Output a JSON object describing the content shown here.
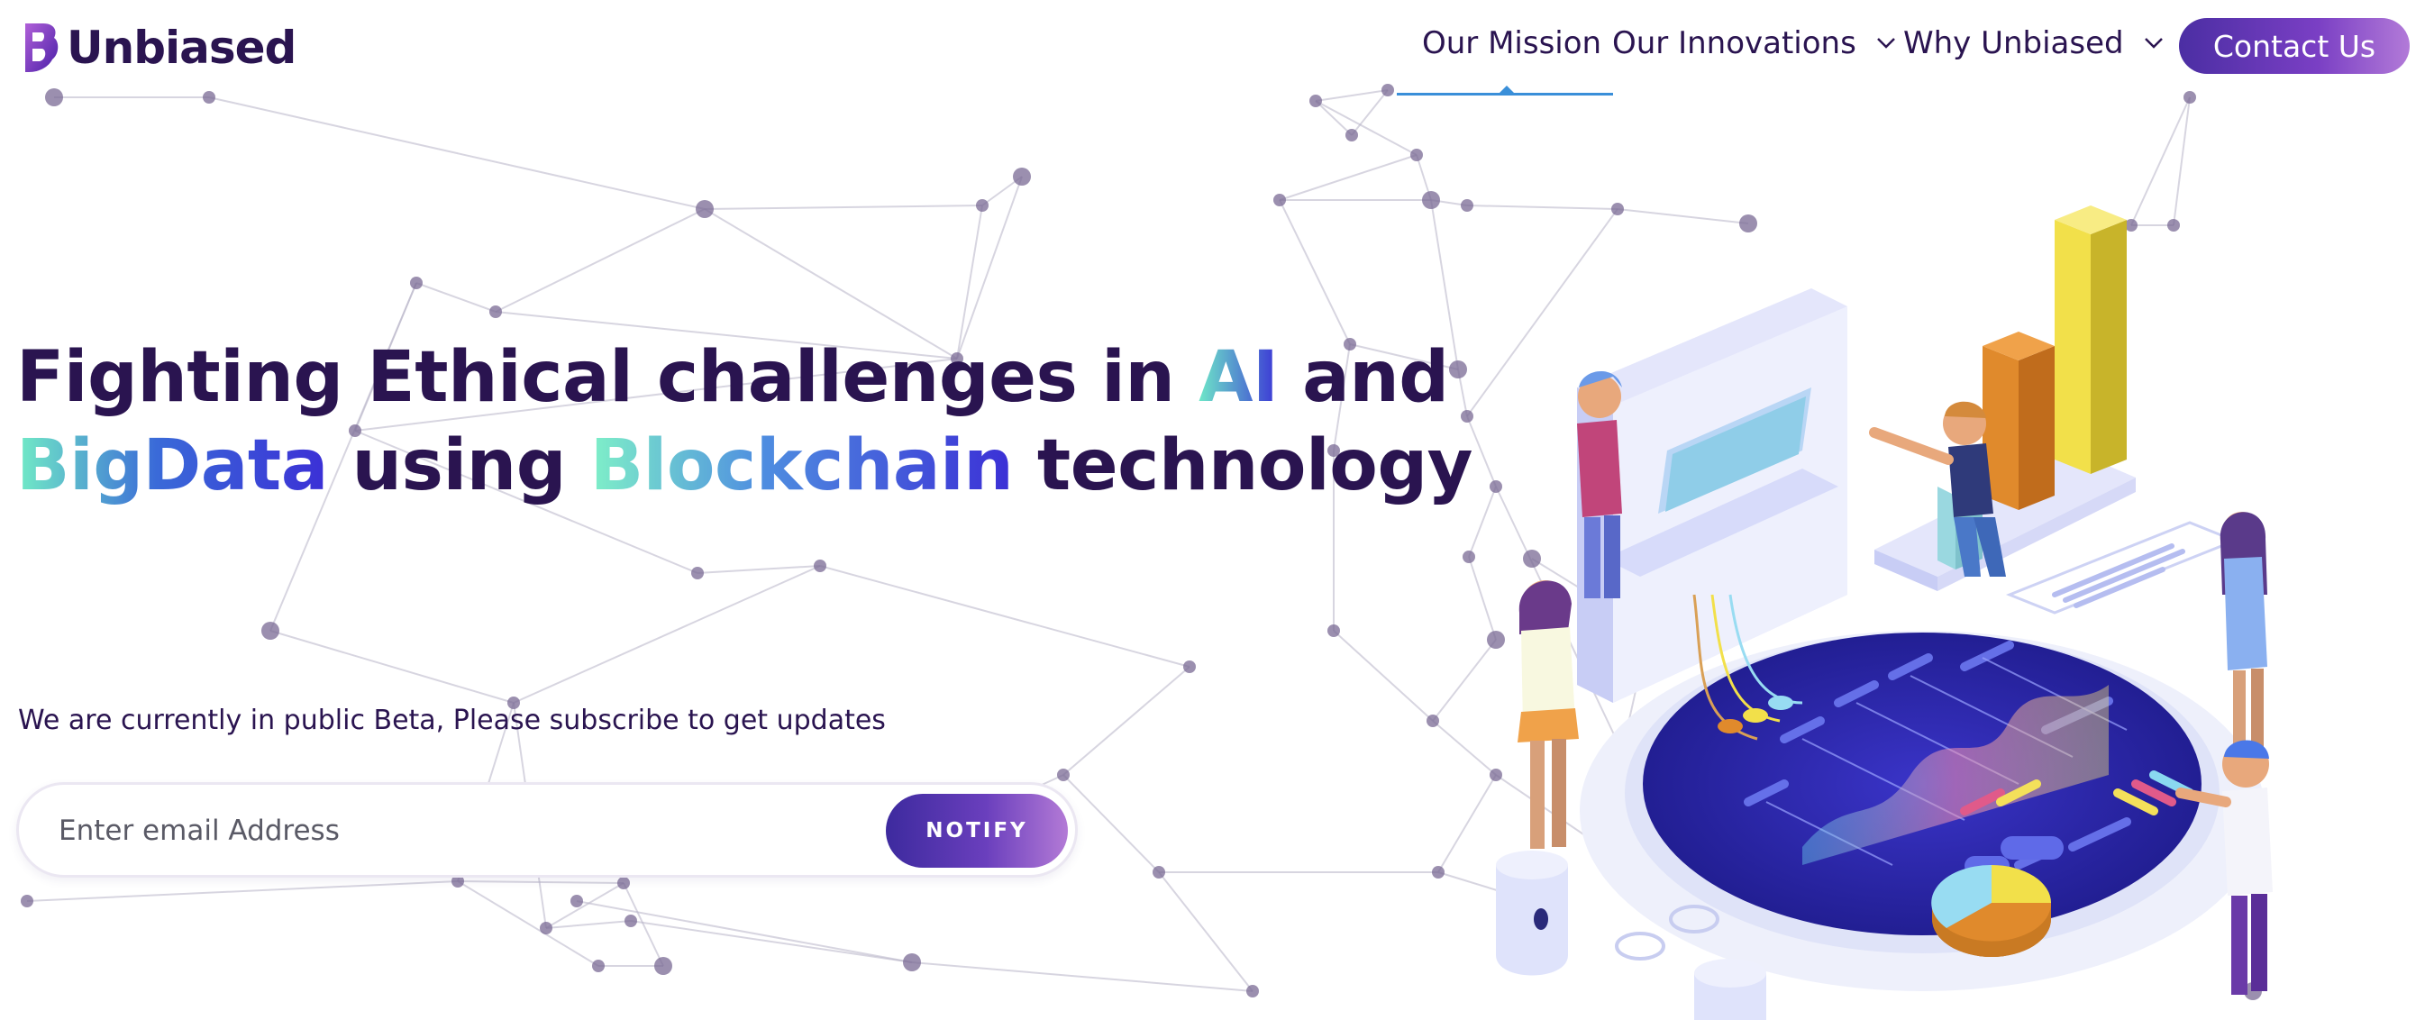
{
  "brand": {
    "name": "Unbiased",
    "logo_icon": "unbiased-b-logo",
    "colors": {
      "primary": "#2a1450",
      "accent_purple": "#6a3fbd",
      "accent_teal": "#6ee8c8",
      "accent_blue": "#3b2fd6",
      "active_underline": "#3a8fd9"
    }
  },
  "nav": {
    "items": [
      {
        "label": "Our Mission",
        "active": true,
        "has_dropdown": false
      },
      {
        "label": "Our Innovations",
        "active": false,
        "has_dropdown": true
      },
      {
        "label": "Why Unbiased",
        "active": false,
        "has_dropdown": true
      }
    ],
    "cta_label": "Contact Us"
  },
  "hero": {
    "title_part1": "Fighting Ethical challenges in ",
    "title_ai": "AI",
    "title_part2": " and",
    "title_bigdata": "BigData",
    "title_part3": " using ",
    "title_blockchain": "Blockchain",
    "title_part4": " technology",
    "beta_text": "We are currently in public Beta, Please subscribe to get updates",
    "email_placeholder": "Enter email Address",
    "email_value": "",
    "notify_label": "NOTIFY"
  }
}
